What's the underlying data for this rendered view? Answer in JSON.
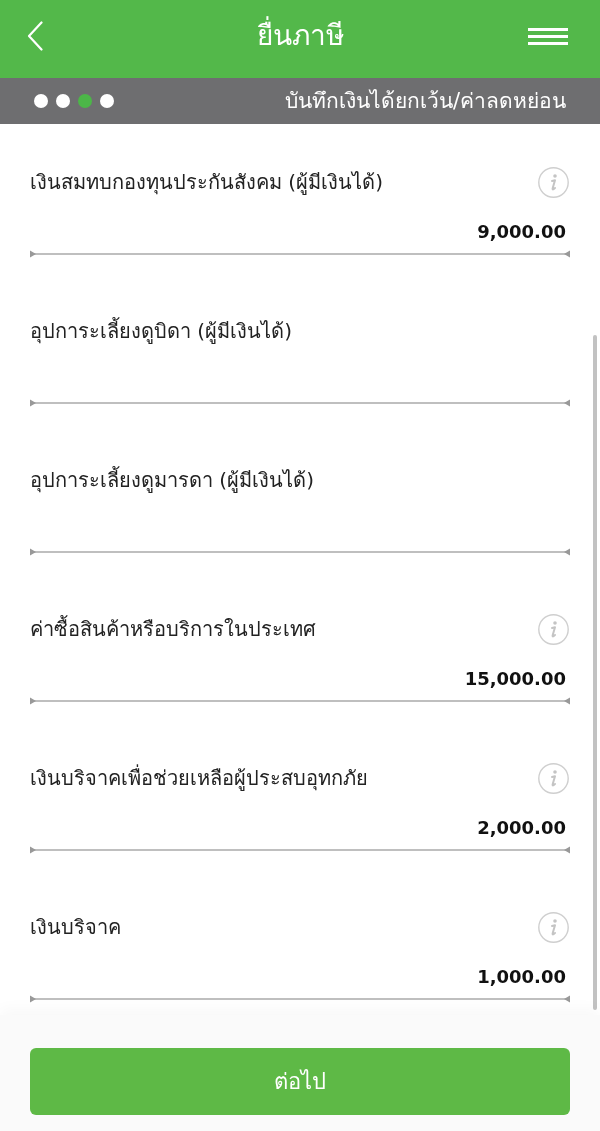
{
  "header": {
    "title": "ยื่นภาษี"
  },
  "steps": {
    "items": [
      {
        "selected": false
      },
      {
        "selected": false
      },
      {
        "selected": true
      },
      {
        "selected": false
      }
    ],
    "title": "บันทึกเงินได้ยกเว้น/ค่าลดหย่อน"
  },
  "fields": [
    {
      "label": "เงินสมทบกองทุนประกันสังคม (ผู้มีเงินได้)",
      "info": true,
      "value": "9,000.00"
    },
    {
      "label": "อุปการะเลี้ยงดูบิดา (ผู้มีเงินได้)",
      "info": false
    },
    {
      "label": "อุปการะเลี้ยงดูมารดา (ผู้มีเงินได้)",
      "info": false
    },
    {
      "label": "ค่าซื้อสินค้าหรือบริการในประเทศ",
      "info": true,
      "value": "15,000.00"
    },
    {
      "label": "เงินบริจาคเพื่อช่วยเหลือผู้ประสบอุทกภัย",
      "info": true,
      "value": "2,000.00"
    },
    {
      "label": "เงินบริจาค",
      "info": true,
      "value": "1,000.00"
    }
  ],
  "next_button": "ต่อไป"
}
